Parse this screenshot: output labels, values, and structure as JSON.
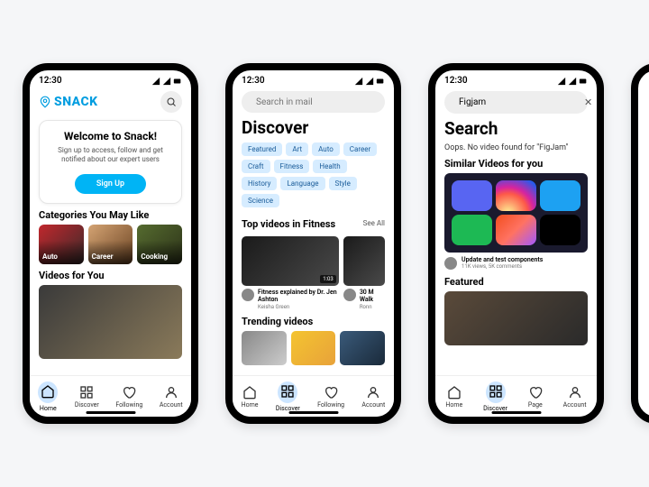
{
  "status": {
    "time": "12:30"
  },
  "nav": {
    "home": "Home",
    "discover": "Discover",
    "following": "Following",
    "page": "Page",
    "account": "Account"
  },
  "screen1": {
    "brand": "SNACK",
    "welcome_title": "Welcome to Snack!",
    "welcome_body": "Sign up to access, follow and get notified about our expert users",
    "signup": "Sign Up",
    "cats_title": "Categories You May Like",
    "cats": [
      "Auto",
      "Career",
      "Cooking"
    ],
    "videos_title": "Videos for You"
  },
  "screen2": {
    "search_placeholder": "Search in mail",
    "title": "Discover",
    "chips": [
      "Featured",
      "Art",
      "Auto",
      "Career",
      "Craft",
      "Fitness",
      "Health",
      "History",
      "Language",
      "Style",
      "Science"
    ],
    "top_title": "Top videos in Fitness",
    "see_all": "See All",
    "v1_dur": "1:03",
    "v1_title": "Fitness explained by Dr. Jen Ashton",
    "v1_author": "Keisha Green",
    "v2_title": "30 M\nWalk",
    "v2_author": "Ronn",
    "trending_title": "Trending videos"
  },
  "screen3": {
    "search_value": "Figjam",
    "title": "Search",
    "oops": "Oops. No video found for \"FigJam\"",
    "similar_title": "Similar Videos for you",
    "item_title": "Update and test components",
    "item_meta": "11K views, 5K comments",
    "featured_title": "Featured"
  }
}
